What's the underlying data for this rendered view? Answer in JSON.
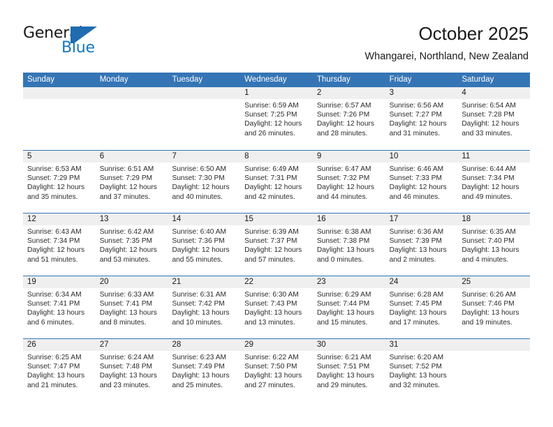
{
  "brand": {
    "name_part1": "General",
    "name_part2": "Blue",
    "logo_icon": "triangle-flag-icon"
  },
  "header": {
    "title": "October 2025",
    "subtitle": "Whangarei, Northland, New Zealand"
  },
  "colors": {
    "header_blue": "#3575b5",
    "brand_blue": "#1878be",
    "day_band_gray": "#efefef",
    "text": "#1a1a1a"
  },
  "weekdays": [
    "Sunday",
    "Monday",
    "Tuesday",
    "Wednesday",
    "Thursday",
    "Friday",
    "Saturday"
  ],
  "weeks": [
    [
      {
        "day": "",
        "sunrise": "",
        "sunset": "",
        "daylight_line1": "",
        "daylight_line2": "",
        "empty": true
      },
      {
        "day": "",
        "sunrise": "",
        "sunset": "",
        "daylight_line1": "",
        "daylight_line2": "",
        "empty": true
      },
      {
        "day": "",
        "sunrise": "",
        "sunset": "",
        "daylight_line1": "",
        "daylight_line2": "",
        "empty": true
      },
      {
        "day": "1",
        "sunrise": "Sunrise: 6:59 AM",
        "sunset": "Sunset: 7:25 PM",
        "daylight_line1": "Daylight: 12 hours",
        "daylight_line2": "and 26 minutes."
      },
      {
        "day": "2",
        "sunrise": "Sunrise: 6:57 AM",
        "sunset": "Sunset: 7:26 PM",
        "daylight_line1": "Daylight: 12 hours",
        "daylight_line2": "and 28 minutes."
      },
      {
        "day": "3",
        "sunrise": "Sunrise: 6:56 AM",
        "sunset": "Sunset: 7:27 PM",
        "daylight_line1": "Daylight: 12 hours",
        "daylight_line2": "and 31 minutes."
      },
      {
        "day": "4",
        "sunrise": "Sunrise: 6:54 AM",
        "sunset": "Sunset: 7:28 PM",
        "daylight_line1": "Daylight: 12 hours",
        "daylight_line2": "and 33 minutes."
      }
    ],
    [
      {
        "day": "5",
        "sunrise": "Sunrise: 6:53 AM",
        "sunset": "Sunset: 7:29 PM",
        "daylight_line1": "Daylight: 12 hours",
        "daylight_line2": "and 35 minutes."
      },
      {
        "day": "6",
        "sunrise": "Sunrise: 6:51 AM",
        "sunset": "Sunset: 7:29 PM",
        "daylight_line1": "Daylight: 12 hours",
        "daylight_line2": "and 37 minutes."
      },
      {
        "day": "7",
        "sunrise": "Sunrise: 6:50 AM",
        "sunset": "Sunset: 7:30 PM",
        "daylight_line1": "Daylight: 12 hours",
        "daylight_line2": "and 40 minutes."
      },
      {
        "day": "8",
        "sunrise": "Sunrise: 6:49 AM",
        "sunset": "Sunset: 7:31 PM",
        "daylight_line1": "Daylight: 12 hours",
        "daylight_line2": "and 42 minutes."
      },
      {
        "day": "9",
        "sunrise": "Sunrise: 6:47 AM",
        "sunset": "Sunset: 7:32 PM",
        "daylight_line1": "Daylight: 12 hours",
        "daylight_line2": "and 44 minutes."
      },
      {
        "day": "10",
        "sunrise": "Sunrise: 6:46 AM",
        "sunset": "Sunset: 7:33 PM",
        "daylight_line1": "Daylight: 12 hours",
        "daylight_line2": "and 46 minutes."
      },
      {
        "day": "11",
        "sunrise": "Sunrise: 6:44 AM",
        "sunset": "Sunset: 7:34 PM",
        "daylight_line1": "Daylight: 12 hours",
        "daylight_line2": "and 49 minutes."
      }
    ],
    [
      {
        "day": "12",
        "sunrise": "Sunrise: 6:43 AM",
        "sunset": "Sunset: 7:34 PM",
        "daylight_line1": "Daylight: 12 hours",
        "daylight_line2": "and 51 minutes."
      },
      {
        "day": "13",
        "sunrise": "Sunrise: 6:42 AM",
        "sunset": "Sunset: 7:35 PM",
        "daylight_line1": "Daylight: 12 hours",
        "daylight_line2": "and 53 minutes."
      },
      {
        "day": "14",
        "sunrise": "Sunrise: 6:40 AM",
        "sunset": "Sunset: 7:36 PM",
        "daylight_line1": "Daylight: 12 hours",
        "daylight_line2": "and 55 minutes."
      },
      {
        "day": "15",
        "sunrise": "Sunrise: 6:39 AM",
        "sunset": "Sunset: 7:37 PM",
        "daylight_line1": "Daylight: 12 hours",
        "daylight_line2": "and 57 minutes."
      },
      {
        "day": "16",
        "sunrise": "Sunrise: 6:38 AM",
        "sunset": "Sunset: 7:38 PM",
        "daylight_line1": "Daylight: 13 hours",
        "daylight_line2": "and 0 minutes."
      },
      {
        "day": "17",
        "sunrise": "Sunrise: 6:36 AM",
        "sunset": "Sunset: 7:39 PM",
        "daylight_line1": "Daylight: 13 hours",
        "daylight_line2": "and 2 minutes."
      },
      {
        "day": "18",
        "sunrise": "Sunrise: 6:35 AM",
        "sunset": "Sunset: 7:40 PM",
        "daylight_line1": "Daylight: 13 hours",
        "daylight_line2": "and 4 minutes."
      }
    ],
    [
      {
        "day": "19",
        "sunrise": "Sunrise: 6:34 AM",
        "sunset": "Sunset: 7:41 PM",
        "daylight_line1": "Daylight: 13 hours",
        "daylight_line2": "and 6 minutes."
      },
      {
        "day": "20",
        "sunrise": "Sunrise: 6:33 AM",
        "sunset": "Sunset: 7:41 PM",
        "daylight_line1": "Daylight: 13 hours",
        "daylight_line2": "and 8 minutes."
      },
      {
        "day": "21",
        "sunrise": "Sunrise: 6:31 AM",
        "sunset": "Sunset: 7:42 PM",
        "daylight_line1": "Daylight: 13 hours",
        "daylight_line2": "and 10 minutes."
      },
      {
        "day": "22",
        "sunrise": "Sunrise: 6:30 AM",
        "sunset": "Sunset: 7:43 PM",
        "daylight_line1": "Daylight: 13 hours",
        "daylight_line2": "and 13 minutes."
      },
      {
        "day": "23",
        "sunrise": "Sunrise: 6:29 AM",
        "sunset": "Sunset: 7:44 PM",
        "daylight_line1": "Daylight: 13 hours",
        "daylight_line2": "and 15 minutes."
      },
      {
        "day": "24",
        "sunrise": "Sunrise: 6:28 AM",
        "sunset": "Sunset: 7:45 PM",
        "daylight_line1": "Daylight: 13 hours",
        "daylight_line2": "and 17 minutes."
      },
      {
        "day": "25",
        "sunrise": "Sunrise: 6:26 AM",
        "sunset": "Sunset: 7:46 PM",
        "daylight_line1": "Daylight: 13 hours",
        "daylight_line2": "and 19 minutes."
      }
    ],
    [
      {
        "day": "26",
        "sunrise": "Sunrise: 6:25 AM",
        "sunset": "Sunset: 7:47 PM",
        "daylight_line1": "Daylight: 13 hours",
        "daylight_line2": "and 21 minutes."
      },
      {
        "day": "27",
        "sunrise": "Sunrise: 6:24 AM",
        "sunset": "Sunset: 7:48 PM",
        "daylight_line1": "Daylight: 13 hours",
        "daylight_line2": "and 23 minutes."
      },
      {
        "day": "28",
        "sunrise": "Sunrise: 6:23 AM",
        "sunset": "Sunset: 7:49 PM",
        "daylight_line1": "Daylight: 13 hours",
        "daylight_line2": "and 25 minutes."
      },
      {
        "day": "29",
        "sunrise": "Sunrise: 6:22 AM",
        "sunset": "Sunset: 7:50 PM",
        "daylight_line1": "Daylight: 13 hours",
        "daylight_line2": "and 27 minutes."
      },
      {
        "day": "30",
        "sunrise": "Sunrise: 6:21 AM",
        "sunset": "Sunset: 7:51 PM",
        "daylight_line1": "Daylight: 13 hours",
        "daylight_line2": "and 29 minutes."
      },
      {
        "day": "31",
        "sunrise": "Sunrise: 6:20 AM",
        "sunset": "Sunset: 7:52 PM",
        "daylight_line1": "Daylight: 13 hours",
        "daylight_line2": "and 32 minutes."
      },
      {
        "day": "",
        "sunrise": "",
        "sunset": "",
        "daylight_line1": "",
        "daylight_line2": "",
        "empty": true
      }
    ]
  ]
}
